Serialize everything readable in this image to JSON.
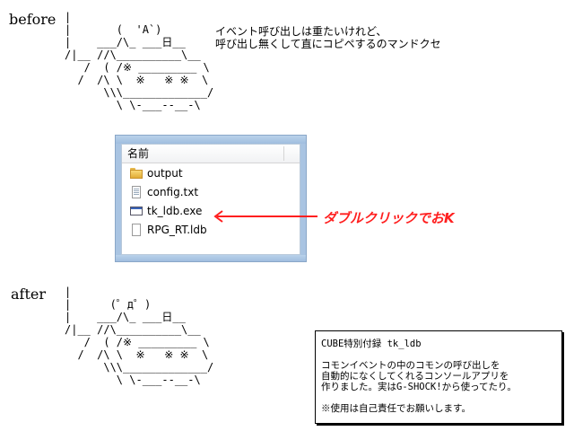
{
  "before": {
    "heading": "before",
    "ascii_art": "|\n|       (  'A`)      \n|    ___/\\_ ___日__\n/|__ //\\__________\\__\n   /  ( /※ _________ \\\n  /  /\\ \\  ※   ※ ※  \\\n      \\\\\\_____________/\n        \\ \\-___--__-\\",
    "note_line1": "イベント呼び出しは重たいけれど、",
    "note_line2": "呼び出し無くして直にコピペするのマンドクセ"
  },
  "explorer": {
    "column_header": "名前",
    "files": [
      {
        "name": "output",
        "icon": "folder-icon"
      },
      {
        "name": "config.txt",
        "icon": "text-file-icon"
      },
      {
        "name": "tk_ldb.exe",
        "icon": "exe-icon"
      },
      {
        "name": "RPG_RT.ldb",
        "icon": "file-icon"
      }
    ]
  },
  "callout": {
    "label": "ダブルクリックでおK",
    "color": "#ff1f1f"
  },
  "after": {
    "heading": "after",
    "ascii_art": "|\n|      (゜д゜)       \n|    ___/\\_ ___日__\n/|__ //\\__________\\__\n   /  ( /※ _________ \\\n  /  /\\ \\  ※   ※ ※  \\\n      \\\\\\_____________/\n        \\ \\-___--__-\\"
  },
  "infobox": {
    "title": "CUBE特別付録  tk_ldb",
    "line1": "コモンイベントの中のコモンの呼び出しを",
    "line2": "自動的になくしてくれるコンソールアプリを",
    "line3": "作りました。実はG-SHOCK!から使ってたり。",
    "line4": "※使用は自己責任でお願いします。"
  }
}
